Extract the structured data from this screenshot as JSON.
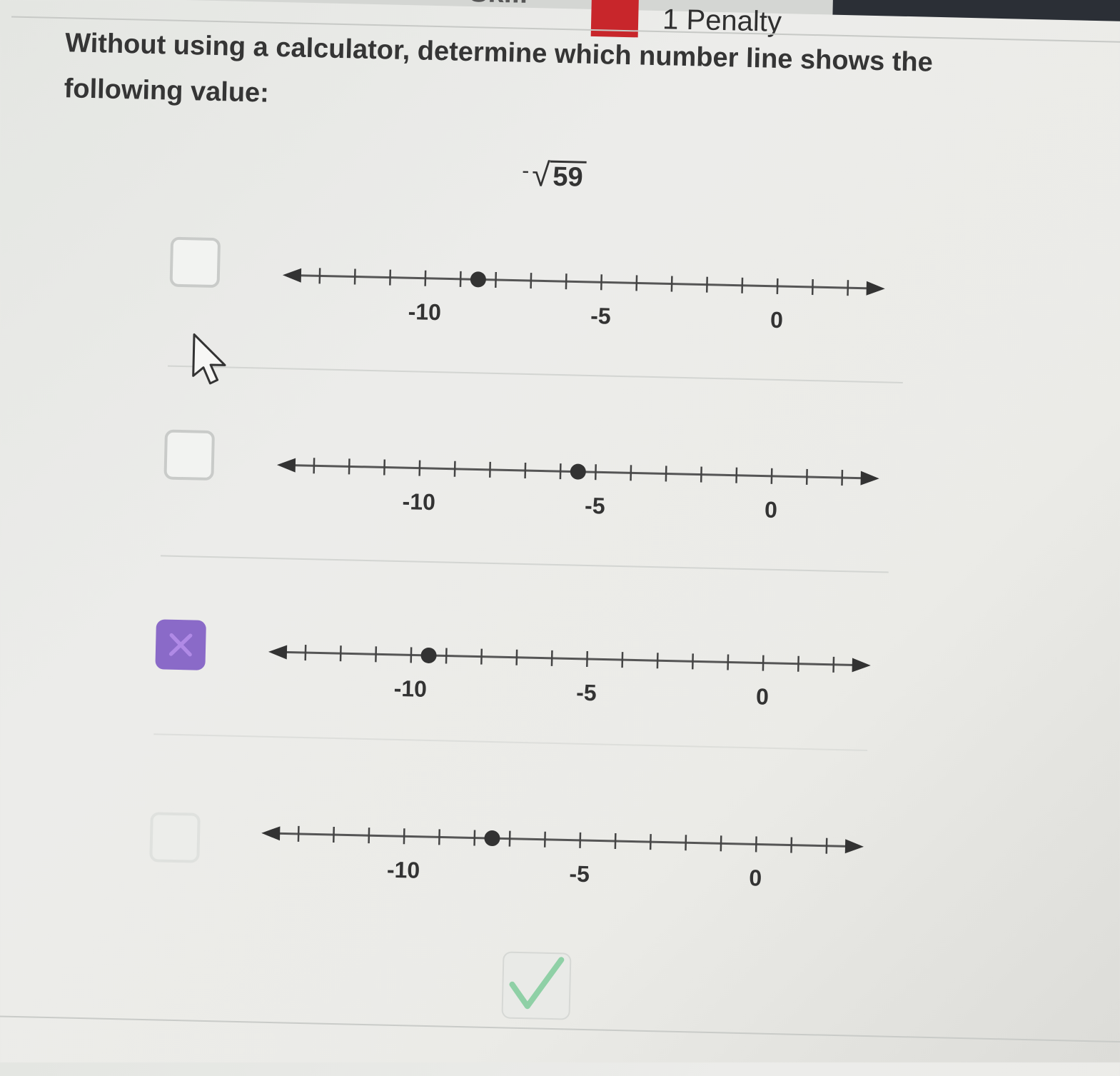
{
  "header": {
    "skill_label": "Skill",
    "penalty_label": "1 Penalty",
    "penalty_color": "#c8262b"
  },
  "question": {
    "prompt": "Without using a calculator, determine which number line shows the following value:",
    "expression_sign": "-",
    "expression_radicand": "59"
  },
  "options": [
    {
      "checked": false,
      "tick_labels": [
        "-10",
        "-5",
        "0"
      ],
      "point_value": -8.5
    },
    {
      "checked": false,
      "tick_labels": [
        "-10",
        "-5",
        "0"
      ],
      "point_value": -5.5
    },
    {
      "checked": true,
      "tick_labels": [
        "-10",
        "-5",
        "0"
      ],
      "point_value": -9.5
    },
    {
      "checked": false,
      "tick_labels": [
        "-10",
        "-5",
        "0"
      ],
      "point_value": -7.5
    }
  ],
  "number_line": {
    "min": -13,
    "max": 2,
    "step": 1
  },
  "colors": {
    "checked_box": "#8a6ac8",
    "submit_check": "#8fd0a6",
    "line": "#555555"
  },
  "icons": {
    "submit": "check-icon",
    "cursor": "mouse-pointer-icon",
    "selected": "x-icon"
  }
}
